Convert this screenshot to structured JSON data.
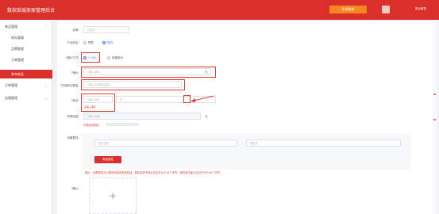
{
  "header": {
    "title": "数权商城卖家管理后台",
    "system_button": "申请商城",
    "user_name": "",
    "logout": "退出登录"
  },
  "sidebar": {
    "group_goods": "商品管理",
    "items": [
      "库存管理",
      "品牌管理",
      "订单管理",
      "发布商品"
    ],
    "group_orders": "订单管理",
    "group_shops": "店铺管理"
  },
  "form": {
    "brand": {
      "label": "品牌：",
      "placeholder": "请选择"
    },
    "status": {
      "label": "产品状态：",
      "options": [
        "预售",
        "现货"
      ]
    },
    "unit": {
      "label": "*报价方式：",
      "options": [
        "一口价",
        "规格报价"
      ]
    },
    "price": {
      "label": "*报价：",
      "placeholder": "请输入报价",
      "suffix": "元"
    },
    "min_qty": {
      "label": "*开始购买数量：",
      "placeholder": "请输入开始购买数量"
    },
    "stock": {
      "label": "*库存：",
      "placeholder": "请输入库存",
      "error": "请输入库存",
      "unit_placeholder": "件"
    },
    "freight": {
      "label": "所需运费：",
      "placeholder": "请输入运费",
      "suffix": "元",
      "note": "可用库存数量："
    },
    "spec": {
      "label": "设置属性：",
      "name_placeholder": "属性名称",
      "value_placeholder": "属性值"
    },
    "add_spec_btn": "添加属性",
    "hint": "提示：设置属性可以更好地描述商品特征，属性名称不能为空且不大于10个字符，属性值不能为空且不大于40个字符",
    "image": {
      "label": "*图片："
    }
  }
}
